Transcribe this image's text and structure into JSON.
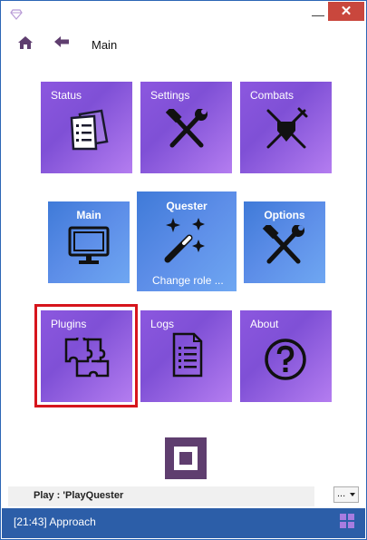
{
  "window": {
    "close_label": "✕",
    "minimize_label": "—"
  },
  "nav": {
    "title": "Main"
  },
  "tiles": [
    {
      "label": "Status",
      "icon": "document-list-icon"
    },
    {
      "label": "Settings",
      "icon": "tools-icon"
    },
    {
      "label": "Combats",
      "icon": "crossed-swords-shield-icon"
    },
    {
      "label": "Main",
      "icon": "monitor-icon"
    },
    {
      "label": "Quester",
      "sublabel": "Change role ...",
      "icon": "magic-wand-icon"
    },
    {
      "label": "Options",
      "icon": "tools-icon"
    },
    {
      "label": "Plugins",
      "icon": "puzzle-icon"
    },
    {
      "label": "Logs",
      "icon": "document-lines-icon"
    },
    {
      "label": "About",
      "icon": "question-circle-icon"
    }
  ],
  "play": {
    "label": "Play : 'PlayQuester",
    "dropdown_value": "..."
  },
  "status": {
    "text": "[21:43] Approach"
  },
  "colors": {
    "tile_purple": "#8c57df",
    "tile_blue": "#3f7ad8",
    "stop_button": "#5f3e6f",
    "status_bar": "#2c5ea8",
    "close_button": "#c9473d",
    "selection": "#d6151c"
  }
}
